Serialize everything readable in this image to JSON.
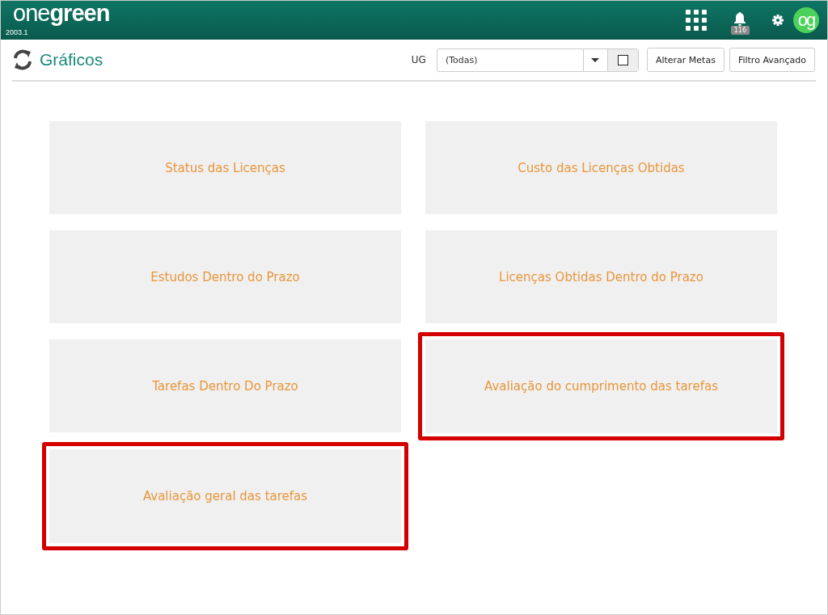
{
  "header": {
    "logo": "one**green**",
    "version": "2003.1",
    "notification_count": "116",
    "avatar_initials": "og"
  },
  "page": {
    "title": "Gráficos"
  },
  "filter": {
    "label": "UG",
    "value": "(Todas)",
    "checked": false
  },
  "buttons": [
    "Alterar Metas",
    "Filtro Avançado"
  ],
  "cards": [
    {
      "label": "Status das Licenças",
      "highlighted": false
    },
    {
      "label": "Custo das Licenças Obtidas",
      "highlighted": false
    },
    {
      "label": "Estudos Dentro do Prazo",
      "highlighted": false
    },
    {
      "label": "Licenças Obtidas Dentro do Prazo",
      "highlighted": false
    },
    {
      "label": "Tarefas Dentro Do Prazo",
      "highlighted": false
    },
    {
      "label": "Avaliação do cumprimento das tarefas",
      "highlighted": true
    },
    {
      "label": "Avaliação geral das tarefas",
      "highlighted": true
    }
  ]
}
